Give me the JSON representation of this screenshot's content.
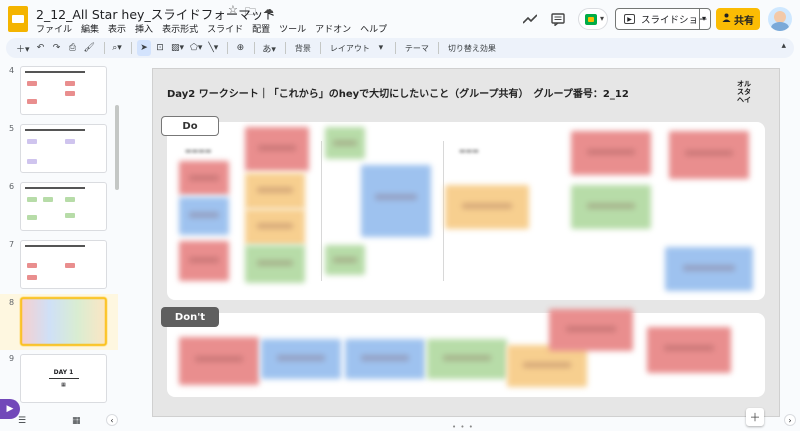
{
  "app": {
    "title": "2_12_All Star hey_スライドフォーマット",
    "title_icons": [
      "☆",
      "🗀",
      "☁"
    ]
  },
  "menu": [
    "ファイル",
    "編集",
    "表示",
    "挿入",
    "表示形式",
    "スライド",
    "配置",
    "ツール",
    "アドオン",
    "ヘルプ"
  ],
  "top_actions": {
    "slideshow_label": "スライドショー",
    "share_label": "共有"
  },
  "toolbar": {
    "bg_label": "背景",
    "layout_label": "レイアウト",
    "theme_label": "テーマ",
    "transition_label": "切り替え効果"
  },
  "filmstrip": {
    "slides": [
      {
        "num": "4"
      },
      {
        "num": "5"
      },
      {
        "num": "6"
      },
      {
        "num": "7"
      },
      {
        "num": "8"
      },
      {
        "num": "9",
        "title": "DAY 1"
      }
    ]
  },
  "slide": {
    "header": "Day2 ワークシート｜「これから」のheyで大切にしたいこと（グループ共有）　グループ番号：2_12",
    "logo": "オル スタ ヘイ",
    "do_label": "Do",
    "dont_label": "Don't"
  },
  "colors": {
    "accent_yellow": "#fbbc04",
    "sticky_red": "#e98e8e",
    "sticky_blue": "#9ec2ef",
    "sticky_green": "#b7dca8",
    "sticky_orange": "#f7cf8f"
  }
}
